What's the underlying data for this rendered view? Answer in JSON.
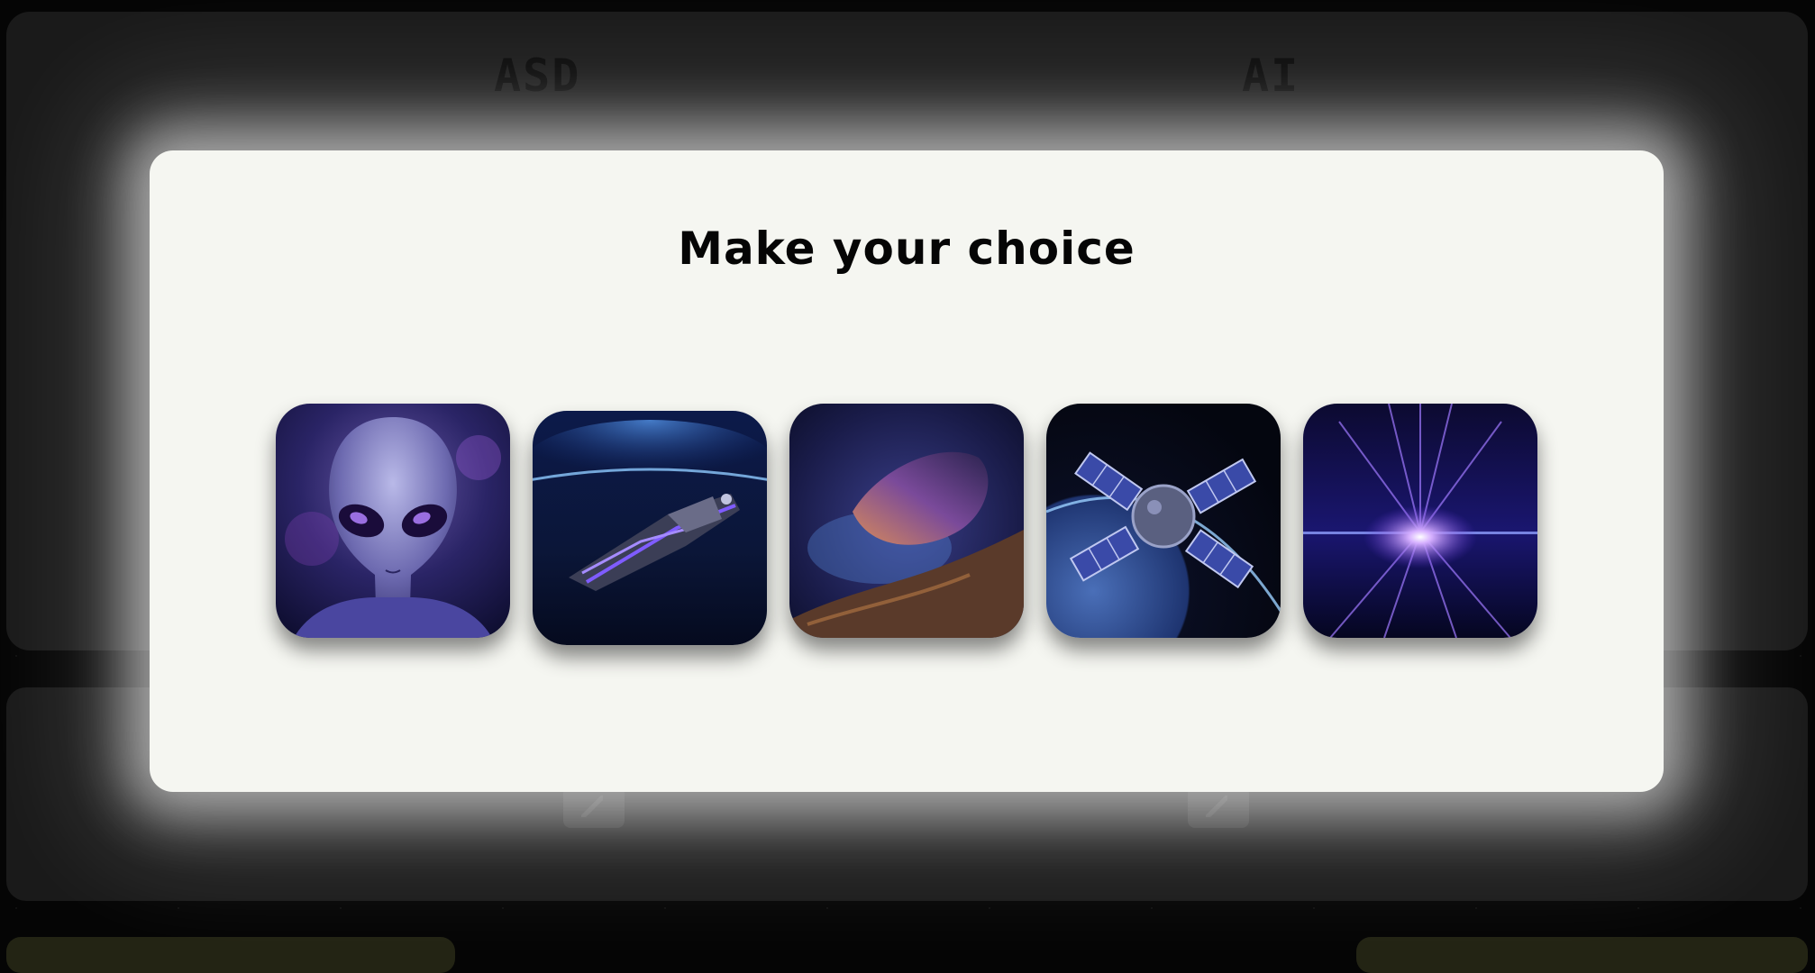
{
  "background": {
    "players": [
      {
        "name": "ASD"
      },
      {
        "name": "AI"
      }
    ]
  },
  "modal": {
    "title": "Make your choice",
    "choices": [
      {
        "icon": "alien-icon"
      },
      {
        "icon": "spaceship-icon"
      },
      {
        "icon": "asteroid-icon"
      },
      {
        "icon": "satellite-icon"
      },
      {
        "icon": "light-burst-icon"
      }
    ]
  },
  "colors": {
    "modal_bg": "#f5f6f1",
    "page_bg": "#050505",
    "panel_bg": "#1a1a1a",
    "accent_purple": "#7b4dff"
  }
}
